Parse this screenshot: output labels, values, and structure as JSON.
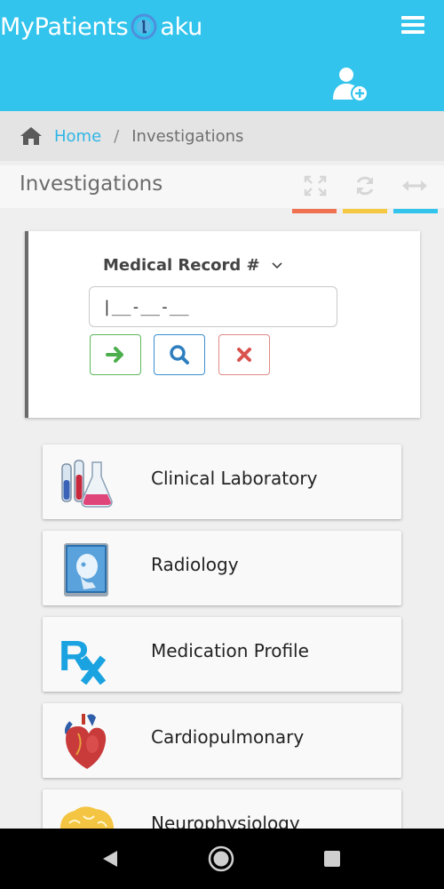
{
  "header": {
    "brand_left": "MyPatients",
    "brand_right": "aku",
    "colors": {
      "bg": "#32c4ec"
    }
  },
  "breadcrumb": {
    "home": "Home",
    "separator": "/",
    "current": "Investigations"
  },
  "panel": {
    "title": "Investigations",
    "tools": [
      "expand-icon",
      "refresh-icon",
      "collapse-arrows-icon"
    ],
    "tool_colors": [
      "#f0714f",
      "#f5c842",
      "#32c4ec"
    ]
  },
  "search": {
    "select_label": "Medical Record #",
    "input_value": "|__-__-__"
  },
  "modules": [
    {
      "label": "Clinical Laboratory",
      "icon": "lab-flasks-icon"
    },
    {
      "label": "Radiology",
      "icon": "xray-head-icon"
    },
    {
      "label": "Medication Profile",
      "icon": "rx-icon"
    },
    {
      "label": "Cardiopulmonary",
      "icon": "heart-icon"
    },
    {
      "label": "Neurophysiology",
      "icon": "brain-icon"
    }
  ]
}
